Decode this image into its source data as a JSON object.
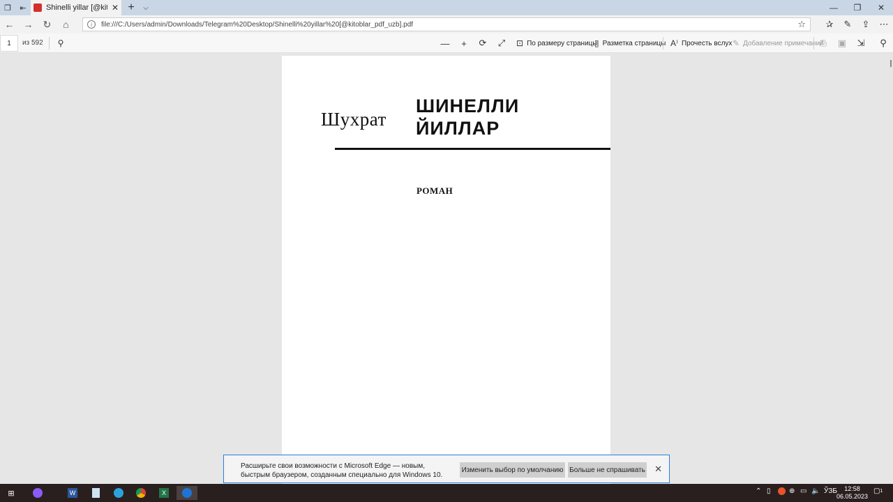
{
  "browser": {
    "tab_title": "Shinelli yillar [@kitoblar",
    "url": "file:///C:/Users/admin/Downloads/Telegram%20Desktop/Shinelli%20yillar%20[@kitoblar_pdf_uzb].pdf"
  },
  "pdf_toolbar": {
    "page_number": "1",
    "page_count": "из 592",
    "fit_page_label": "По размеру страницы",
    "layout_label": "Разметка страницы",
    "read_aloud_label": "Прочесть вслух",
    "add_notes_label": "Добавление примечаний"
  },
  "document": {
    "author": "Шухрат",
    "title_line1": "ШИНЕЛЛИ",
    "title_line2": "ЙИЛЛАР",
    "genre": "РОМАН"
  },
  "notification": {
    "message": "Расширьте свои возможности с Microsoft Edge — новым, быстрым браузером, созданным специально для Windows 10.",
    "change_default_button": "Изменить выбор по умолчанию",
    "dont_ask_button": "Больше не спрашивать"
  },
  "taskbar": {
    "language": "ЎЗБ",
    "time": "12:58",
    "date": "06.05.2023",
    "notification_count": "1"
  }
}
